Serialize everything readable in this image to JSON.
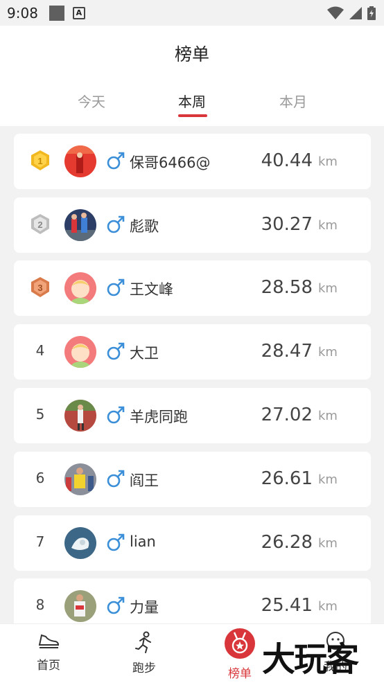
{
  "status_bar": {
    "time": "9:08",
    "a_glyph": "A"
  },
  "header": {
    "title": "榜单"
  },
  "tabs": [
    {
      "label": "今天",
      "active": false
    },
    {
      "label": "本周",
      "active": true
    },
    {
      "label": "本月",
      "active": false
    }
  ],
  "colors": {
    "accent": "#d8363a",
    "gender_male": "#3a8fd8",
    "gold": "#f2b81f",
    "silver": "#c8c8c8",
    "bronze": "#e0895a"
  },
  "leaderboard": [
    {
      "rank": "1",
      "name": "保哥6466@",
      "distance": "40.44",
      "unit": "km",
      "gender": "male"
    },
    {
      "rank": "2",
      "name": "彪歌",
      "distance": "30.27",
      "unit": "km",
      "gender": "male"
    },
    {
      "rank": "3",
      "name": "王文峰",
      "distance": "28.58",
      "unit": "km",
      "gender": "male"
    },
    {
      "rank": "4",
      "name": "大卫",
      "distance": "28.47",
      "unit": "km",
      "gender": "male"
    },
    {
      "rank": "5",
      "name": "羊虎同跑",
      "distance": "27.02",
      "unit": "km",
      "gender": "male"
    },
    {
      "rank": "6",
      "name": "阎王",
      "distance": "26.61",
      "unit": "km",
      "gender": "male"
    },
    {
      "rank": "7",
      "name": "lian",
      "distance": "26.28",
      "unit": "km",
      "gender": "male"
    },
    {
      "rank": "8",
      "name": "力量",
      "distance": "25.41",
      "unit": "km",
      "gender": "male"
    }
  ],
  "bottom_nav": [
    {
      "label": "首页",
      "icon": "shoe-icon",
      "active": false
    },
    {
      "label": "跑步",
      "icon": "runner-icon",
      "active": false
    },
    {
      "label": "榜单",
      "icon": "medal-icon",
      "active": true
    },
    {
      "label": "我的",
      "icon": "profile-icon",
      "active": false
    }
  ],
  "watermark": "大玩客"
}
